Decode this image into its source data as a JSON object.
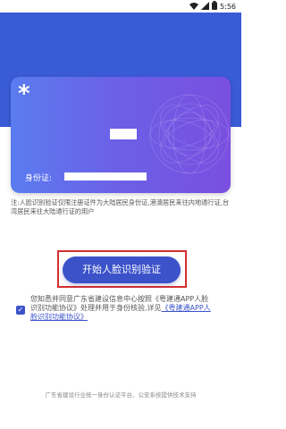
{
  "status_bar": {
    "time": "5:56"
  },
  "card": {
    "symbol": "*",
    "id_label": "身份证:"
  },
  "notice": "注:人脸识别验证仅限注册证件为大陆居民身份证,港澳居民来往内地通行证,台湾居民来往大陆通行证的用户",
  "start_button": "开始人脸识别验证",
  "agreement": {
    "checked": true,
    "text_before": "您知悉并同意广东省建设信息中心按照《粤建通APP人脸识别功能协议》处理并用于身份核验,详见",
    "link": "《粤建通APP人脸识别功能协议》"
  },
  "footer": "广东省建设行业统一身份认证平台、公安系统提供技术支持",
  "colors": {
    "primary": "#3b52c9",
    "header": "#3a5bd6",
    "highlight_border": "#d32f2f"
  }
}
